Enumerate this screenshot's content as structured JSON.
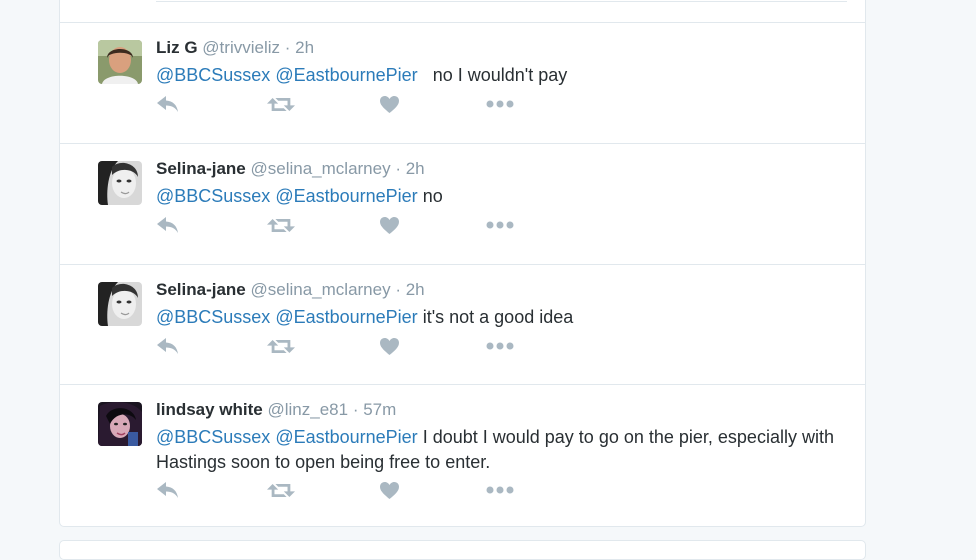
{
  "colors": {
    "background": "#f5f8fa",
    "card": "#ffffff",
    "border": "#e1e8ed",
    "name": "#292f33",
    "meta": "#8899a6",
    "mention": "#2b7bb9",
    "icon": "#aab8c2"
  },
  "tweets": [
    {
      "name": "Liz G",
      "handle": "@trivvieliz",
      "time": "· 2h",
      "mention1": "@BBCSussex",
      "mention2": "@EastbournePier",
      "text": "  no I wouldn't pay",
      "avatar": "woman-portrait"
    },
    {
      "name": "Selina-jane",
      "handle": "@selina_mclarney",
      "time": "· 2h",
      "mention1": "@BBCSussex",
      "mention2": "@EastbournePier",
      "text": "no",
      "avatar": "woman-portrait-bw"
    },
    {
      "name": "Selina-jane",
      "handle": "@selina_mclarney",
      "time": "· 2h",
      "mention1": "@BBCSussex",
      "mention2": "@EastbournePier",
      "text": "it's not a good idea",
      "avatar": "woman-portrait-bw"
    },
    {
      "name": "lindsay white",
      "handle": "@linz_e81",
      "time": "· 57m",
      "mention1": "@BBCSussex",
      "mention2": "@EastbournePier",
      "text": "I doubt I would pay to go on the pier, especially with Hastings soon to open being free to enter.",
      "avatar": "woman-portrait-dark"
    }
  ],
  "icons": {
    "reply": "reply-icon",
    "retweet": "retweet-icon",
    "like": "heart-icon",
    "more": "more-icon"
  }
}
